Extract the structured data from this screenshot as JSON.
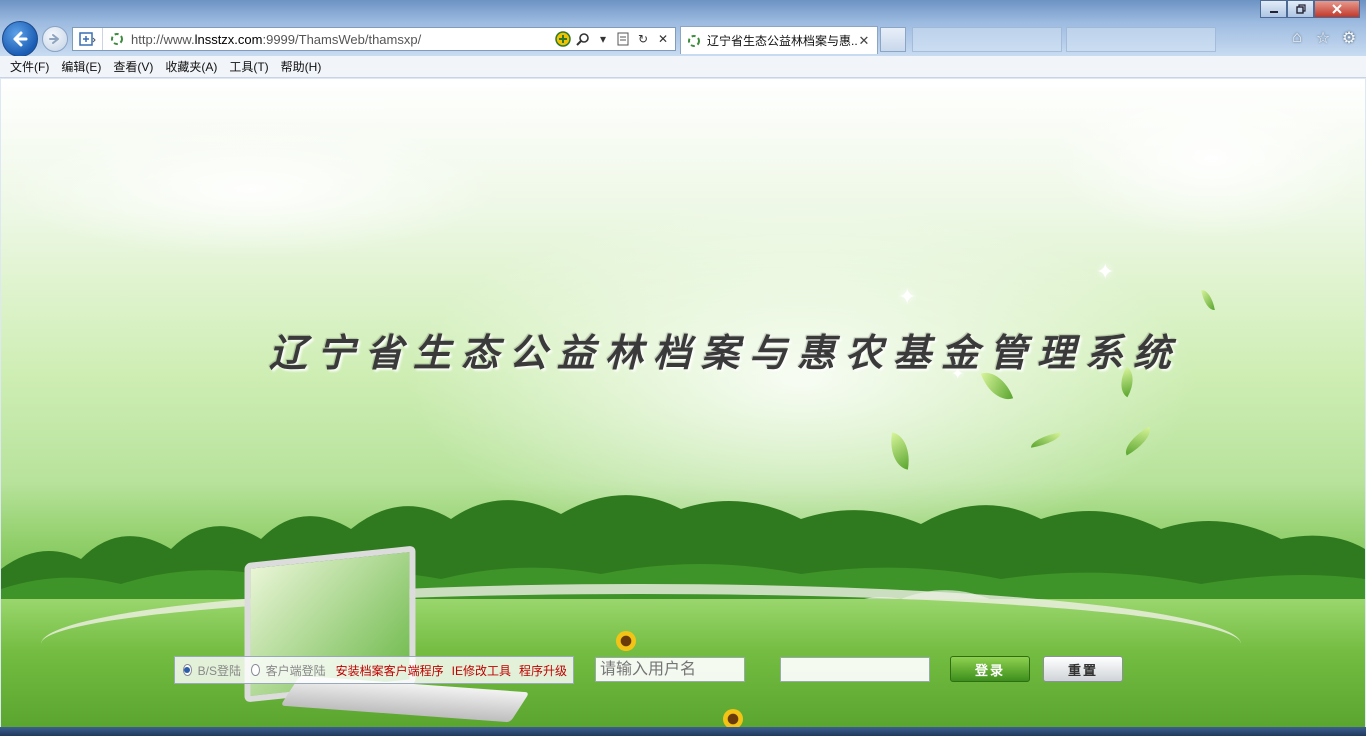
{
  "browser": {
    "url_prefix": "http://www.",
    "url_domain": "lnsstzx.com",
    "url_rest": ":9999/ThamsWeb/thamsxp/",
    "active_tab_title": "辽宁省生态公益林档案与惠...",
    "bg_tabs": [
      "",
      ""
    ],
    "menu": [
      "文件(F)",
      "编辑(E)",
      "查看(V)",
      "收藏夹(A)",
      "工具(T)",
      "帮助(H)"
    ]
  },
  "page": {
    "system_title": "辽宁省生态公益林档案与惠农基金管理系统",
    "login": {
      "mode_bs": "B/S登陆",
      "mode_client": "客户端登陆",
      "link_install": "安装档案客户端程序",
      "link_ie_tool": "IE修改工具",
      "link_upgrade": "程序升级",
      "username_placeholder": "请输入用户名",
      "login_label": "登录",
      "reset_label": "重置"
    }
  },
  "icons": {
    "back": "back-arrow-icon",
    "forward": "forward-arrow-icon",
    "search": "search-icon",
    "refresh": "refresh-icon",
    "stop": "stop-icon",
    "home": "home-icon",
    "favorites": "star-icon",
    "tools": "gear-icon"
  },
  "colors": {
    "link_red": "#c00000",
    "login_green": "#3c8f1c"
  }
}
